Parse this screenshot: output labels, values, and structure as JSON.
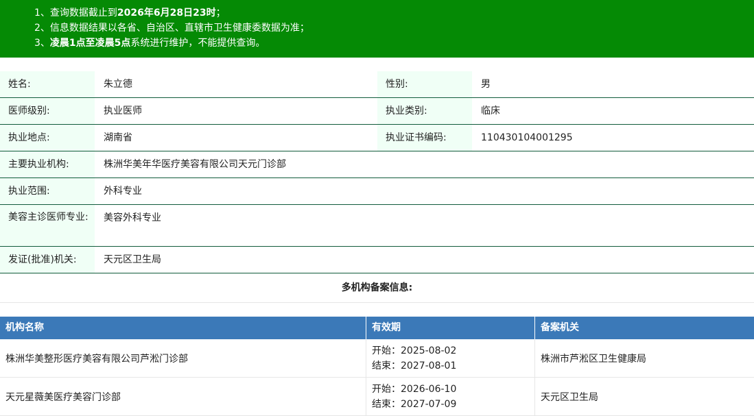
{
  "notice": {
    "line1_prefix": "1、查询数据截止到",
    "line1_bold": "2026年6月28日23时",
    "line1_suffix": "；",
    "line2": "2、信息数据结果以各省、自治区、直辖市卫生健康委数据为准；",
    "line3_prefix": "3、",
    "line3_bold": "凌晨1点至凌晨5点",
    "line3_suffix": "系统进行维护，不能提供查询。"
  },
  "doctor": {
    "name_label": "姓名:",
    "name": "朱立德",
    "gender_label": "性别:",
    "gender": "男",
    "level_label": "医师级别:",
    "level": "执业医师",
    "category_label": "执业类别:",
    "category": "临床",
    "location_label": "执业地点:",
    "location": "湖南省",
    "cert_label": "执业证书编码:",
    "cert": "110430104001295",
    "org_label": "主要执业机构:",
    "org": "株洲华美年华医疗美容有限公司天元门诊部",
    "scope_label": "执业范围:",
    "scope": "外科专业",
    "beauty_label": "美容主诊医师专业:",
    "beauty": "美容外科专业",
    "issuer_label": "发证(批准)机关:",
    "issuer": "天元区卫生局"
  },
  "multi": {
    "title": "多机构备案信息:",
    "headers": [
      "机构名称",
      "有效期",
      "备案机关"
    ],
    "rows": [
      {
        "name": "株洲华美整形医疗美容有限公司芦淞门诊部",
        "start": "开始：2025-08-02",
        "end": "结束：2027-08-01",
        "authority": "株洲市芦淞区卫生健康局"
      },
      {
        "name": "天元星薇美医疗美容门诊部",
        "start": "开始：2026-06-10",
        "end": "结束：2027-07-09",
        "authority": "天元区卫生局"
      }
    ]
  },
  "colors": {
    "notice_bg": "#058a05",
    "header_bg": "#3b79b8",
    "label_bg": "#f0fff6"
  }
}
